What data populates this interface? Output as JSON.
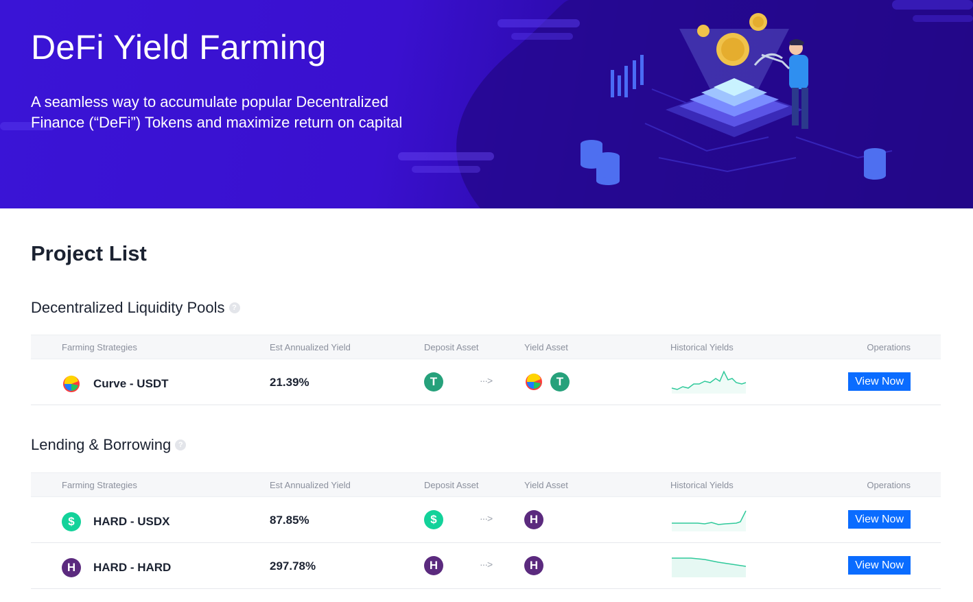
{
  "hero": {
    "title": "DeFi Yield Farming",
    "subtitle": "A seamless way to accumulate popular Decentralized Finance (“DeFi”) Tokens and maximize return on capital"
  },
  "page_title": "Project List",
  "columns": {
    "strategy": "Farming Strategies",
    "yield": "Est Annualized Yield",
    "deposit": "Deposit Asset",
    "yield_asset": "Yield Asset",
    "history": "Historical Yields",
    "operations": "Operations"
  },
  "sections": [
    {
      "title": "Decentralized Liquidity Pools",
      "rows": [
        {
          "strategy": "Curve - USDT",
          "yield": "21.39%",
          "button": "View Now",
          "strategy_icon": "curve-icon",
          "deposit_icons": [
            "usdt-icon"
          ],
          "yield_icons": [
            "curve-icon",
            "usdt-icon"
          ]
        }
      ]
    },
    {
      "title": "Lending & Borrowing",
      "rows": [
        {
          "strategy": "HARD - USDX",
          "yield": "87.85%",
          "button": "View Now",
          "strategy_icon": "usdx-icon",
          "deposit_icons": [
            "usdx-icon"
          ],
          "yield_icons": [
            "hard-icon"
          ]
        },
        {
          "strategy": "HARD - HARD",
          "yield": "297.78%",
          "button": "View Now",
          "strategy_icon": "hard-icon",
          "deposit_icons": [
            "hard-icon"
          ],
          "yield_icons": [
            "hard-icon"
          ]
        }
      ]
    }
  ],
  "colors": {
    "accent": "#0a6cff",
    "spark": "#2ec99a",
    "hero": "#3a14d6"
  }
}
